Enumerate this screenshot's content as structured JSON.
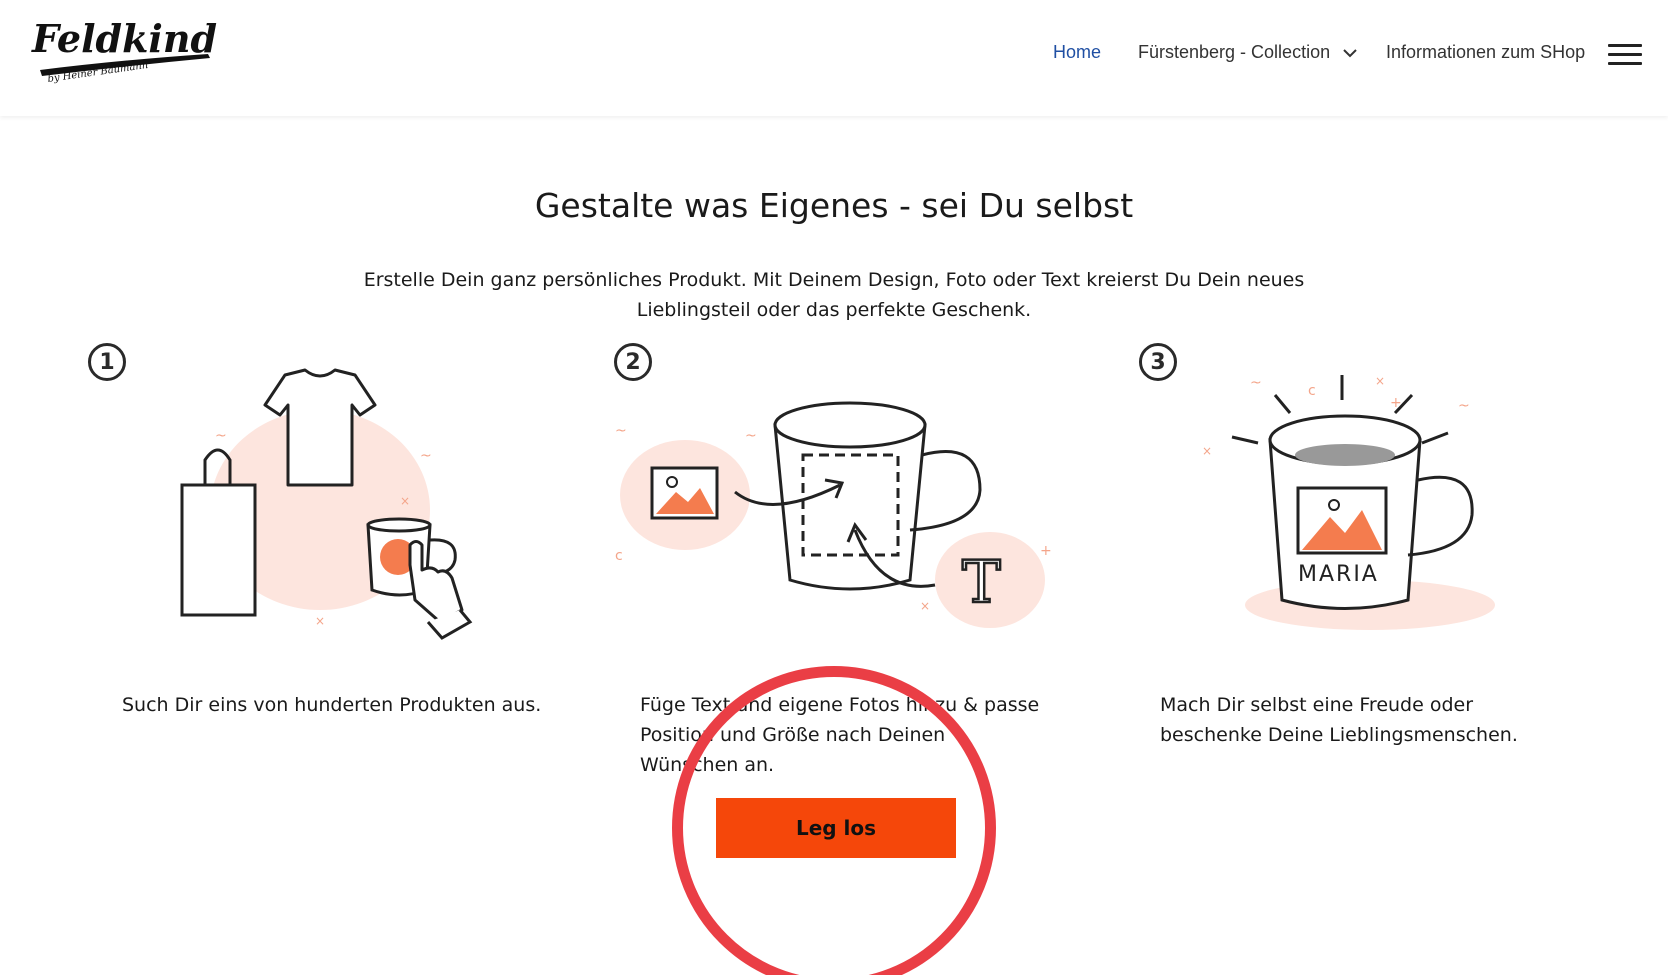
{
  "header": {
    "logo_text": "Feldkind",
    "logo_subtext": "by Heiner Baumann",
    "nav": [
      {
        "label": "Home",
        "active": true
      },
      {
        "label": "Fürstenberg - Collection",
        "has_dropdown": true
      },
      {
        "label": "Informationen zum SHop"
      }
    ],
    "menu_icon": "hamburger-menu-icon",
    "active_color": "#1f4fa3"
  },
  "main": {
    "headline": "Gestalte was Eigenes - sei Du selbst",
    "intro": "Erstelle Dein ganz persönliches Produkt. Mit Deinem Design, Foto oder Text kreierst Du Dein neues Lieblingsteil oder das perfekte Geschenk.",
    "steps": [
      {
        "number": "1",
        "text": "Such Dir eins von hunderten Produkten aus.",
        "icon": "products-illustration"
      },
      {
        "number": "2",
        "text": "Füge Text und eigene Fotos hinzu & passe Position und Größe nach Deinen Wünschen an.",
        "icon": "personalize-mug-illustration"
      },
      {
        "number": "3",
        "text": "Mach Dir selbst eine Freude oder beschenke Deine Lieblingsmenschen.",
        "icon": "personalized-mug-illustration",
        "mug_label": "MARIA"
      }
    ],
    "cta_label": "Leg los",
    "cta_color": "#f5470a"
  },
  "annotation": {
    "type": "circle-highlight",
    "color": "#ea3e45"
  }
}
